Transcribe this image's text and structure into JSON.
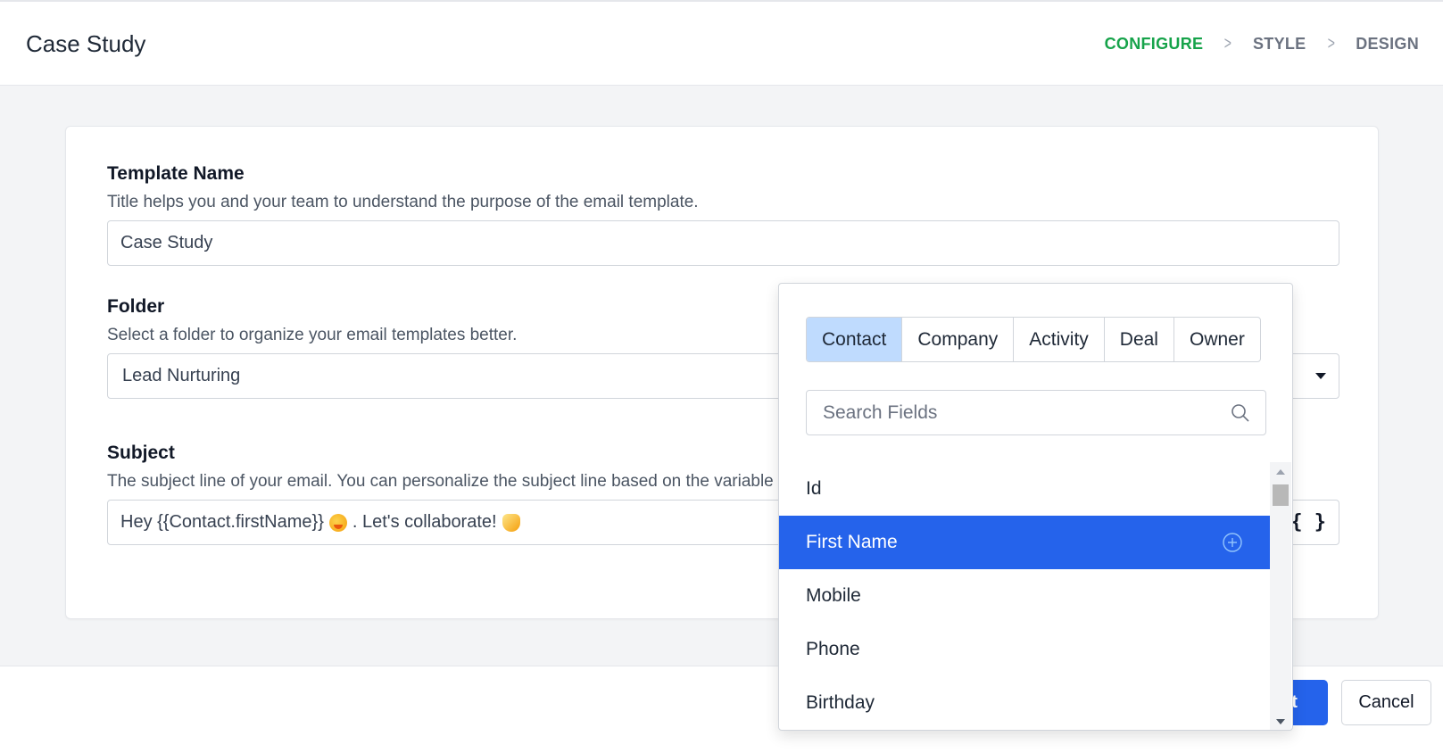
{
  "header": {
    "title": "Case Study",
    "steps": [
      {
        "label": "CONFIGURE",
        "active": true
      },
      {
        "label": "STYLE",
        "active": false
      },
      {
        "label": "DESIGN",
        "active": false
      }
    ]
  },
  "form": {
    "template_name": {
      "title": "Template Name",
      "description": "Title helps you and your team to understand the purpose of the email template.",
      "value": "Case Study"
    },
    "folder": {
      "title": "Folder",
      "description": "Select a folder to organize your email templates better.",
      "value": "Lead Nurturing"
    },
    "subject": {
      "title": "Subject",
      "description": "The subject line of your email. You can personalize the subject line based on the variable",
      "value_part1": "Hey {{Contact.firstName}}",
      "value_part2": ". Let's collaborate!",
      "variable_button": "{ }"
    }
  },
  "footer": {
    "next_label": "xt",
    "cancel_label": "Cancel"
  },
  "variable_picker": {
    "tabs": [
      {
        "label": "Contact",
        "active": true
      },
      {
        "label": "Company",
        "active": false
      },
      {
        "label": "Activity",
        "active": false
      },
      {
        "label": "Deal",
        "active": false
      },
      {
        "label": "Owner",
        "active": false
      }
    ],
    "search_placeholder": "Search Fields",
    "fields": [
      {
        "label": "Id",
        "selected": false
      },
      {
        "label": "First Name",
        "selected": true
      },
      {
        "label": "Mobile",
        "selected": false
      },
      {
        "label": "Phone",
        "selected": false
      },
      {
        "label": "Birthday",
        "selected": false
      }
    ]
  },
  "colors": {
    "active_step": "#16a34a",
    "primary": "#2563eb",
    "active_tab": "#bfdbfe"
  }
}
